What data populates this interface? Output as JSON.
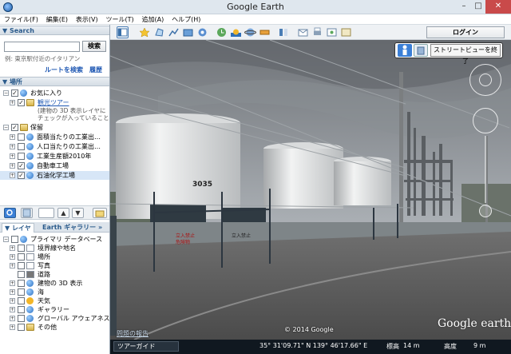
{
  "window": {
    "title": "Google Earth",
    "controls": [
      "–",
      "□",
      "✕"
    ]
  },
  "menu": [
    "ファイル(F)",
    "編集(E)",
    "表示(V)",
    "ツール(T)",
    "追加(A)",
    "ヘルプ(H)"
  ],
  "toolbar": {
    "login_label": "ログイン",
    "icons": [
      "sidebar-toggle-icon",
      "placemark-icon",
      "polygon-icon",
      "path-icon",
      "image-overlay-icon",
      "tour-record-icon",
      "historical-imagery-icon",
      "sun-icon",
      "planets-icon",
      "ruler-icon",
      "email-icon",
      "print-icon",
      "save-image-icon",
      "view-in-maps-icon"
    ]
  },
  "search": {
    "header": "▼ Search",
    "placeholder": "",
    "button_label": "検索",
    "hint": "例: 東京駅付近のイタリアン",
    "route_link": "ルートを検索",
    "history_link": "履歴"
  },
  "places": {
    "header": "▼ 場所",
    "items": [
      {
        "label": "お気に入り",
        "checked": true,
        "expanded": "−",
        "icon": "globe"
      },
      {
        "label": "観光ツアー",
        "checked": true,
        "expanded": "+",
        "icon": "folder",
        "link": true
      },
      {
        "label": "(建物の 3D 表示レイヤに",
        "sub": true
      },
      {
        "label": "チェックが入っていることを",
        "sub": true
      },
      {
        "label": "保留",
        "checked": true,
        "expanded": "−",
        "icon": "folder"
      },
      {
        "label": "面積当たりの工業出…",
        "checked": false,
        "expanded": "+",
        "icon": "globe"
      },
      {
        "label": "人口当たりの工業出…",
        "checked": false,
        "expanded": "+",
        "icon": "globe"
      },
      {
        "label": "工業生産額2010年",
        "checked": false,
        "expanded": "+",
        "icon": "globe"
      },
      {
        "label": "自動車工場",
        "checked": true,
        "expanded": "+",
        "icon": "globe"
      },
      {
        "label": "石油化学工場",
        "checked": true,
        "expanded": "+",
        "icon": "globe",
        "selected": true
      }
    ]
  },
  "layers": {
    "tab_layers": "▼ レイヤ",
    "tab_gallery": "Earth ギャラリー",
    "gallery_arrow": "»",
    "items": [
      {
        "label": "プライマリ データベース",
        "checked": false,
        "expanded": "−",
        "icon": "globe"
      },
      {
        "label": "境界線や地名",
        "checked": false,
        "expanded": "+",
        "icon": "file"
      },
      {
        "label": "場所",
        "checked": false,
        "expanded": "+",
        "icon": "file"
      },
      {
        "label": "写真",
        "checked": false,
        "expanded": "+",
        "icon": "file"
      },
      {
        "label": "道路",
        "checked": false,
        "expanded": "",
        "icon": "file"
      },
      {
        "label": "建物の 3D 表示",
        "checked": false,
        "expanded": "+",
        "icon": "globe"
      },
      {
        "label": "海",
        "checked": false,
        "expanded": "+",
        "icon": "globe"
      },
      {
        "label": "天気",
        "checked": false,
        "expanded": "+",
        "icon": "sun"
      },
      {
        "label": "ギャラリー",
        "checked": false,
        "expanded": "+",
        "icon": "globe"
      },
      {
        "label": "グローバル アウェアネス",
        "checked": false,
        "expanded": "+",
        "icon": "globe"
      },
      {
        "label": "その他",
        "checked": false,
        "expanded": "+",
        "icon": "folder"
      }
    ]
  },
  "streetview": {
    "exit_label": "ストリートビューを終了"
  },
  "scene": {
    "tank_number": "3035",
    "sign_text_1": "立入禁止",
    "sign_text_2": "危険物",
    "sign_text_3": "立入禁止",
    "report_link": "問題の報告",
    "copyright": "© 2014 Google",
    "logo": "Google earth"
  },
  "statusbar": {
    "tour_label": "ツアーガイド",
    "coords": "35° 31'09.71\" N  139° 46'17.66\" E",
    "elev_label": "標高",
    "elev_value": "14 m",
    "eye_label": "高度",
    "eye_value": "9 m"
  },
  "colors": {
    "accent": "#2b5b8c",
    "link": "#1f58b3",
    "selected_row": "#d7e6f7"
  }
}
